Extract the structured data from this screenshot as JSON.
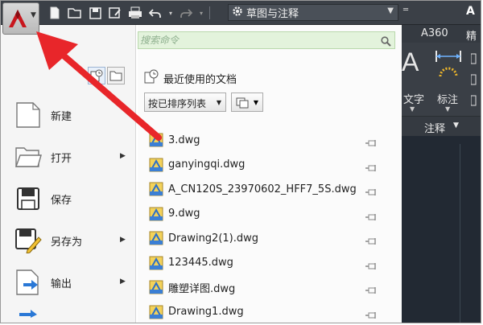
{
  "titlebar": {
    "workspace": "草图与注释",
    "app_letter": "A",
    "quick_access": [
      "new-icon",
      "open-icon",
      "save-icon",
      "saveas-icon",
      "print-icon",
      "undo-icon",
      "redo-icon"
    ]
  },
  "ribbon": {
    "tabs": [
      "A360",
      "精"
    ],
    "text_label": "文字",
    "annotation_label": "标注",
    "panel_title": "注释"
  },
  "app_menu": {
    "search_placeholder": "搜索命令",
    "recent_title": "最近使用的文档",
    "sort_label": "按已排序列表",
    "commands": [
      {
        "label": "新建",
        "icon": "new-document-icon",
        "has_submenu": false
      },
      {
        "label": "打开",
        "icon": "open-folder-icon",
        "has_submenu": true
      },
      {
        "label": "保存",
        "icon": "save-disk-icon",
        "has_submenu": false
      },
      {
        "label": "另存为",
        "icon": "saveas-disk-icon",
        "has_submenu": true
      },
      {
        "label": "输出",
        "icon": "export-icon",
        "has_submenu": true
      }
    ],
    "recent_files": [
      "3.dwg",
      "ganyingqi.dwg",
      "A_CN120S_23970602_HFF7_5S.dwg",
      "9.dwg",
      "Drawing2(1).dwg",
      "123445.dwg",
      "雕塑详图.dwg",
      "Drawing1.dwg"
    ]
  },
  "colors": {
    "arrow": "#e8262a",
    "search_bg": "#e3f3dc",
    "titlebar": "#3b4047"
  }
}
